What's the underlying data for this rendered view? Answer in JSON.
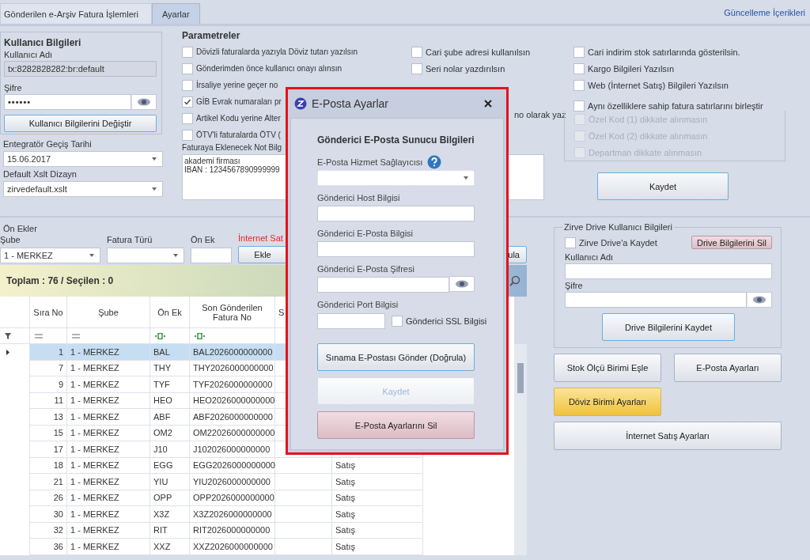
{
  "tabs": [
    {
      "label": "Gönderilen e-Arşiv Fatura İşlemleri",
      "selected": false
    },
    {
      "label": "Ayarlar",
      "selected": true
    }
  ],
  "update_link": "Güncelleme İçerikleri",
  "user_info": {
    "title": "Kullanıcı Bilgileri",
    "username_label": "Kullanıcı Adı",
    "username": "tx:8282828282:br:default",
    "password_label": "Şifre",
    "password": "••••••",
    "change_button": "Kullanıcı Bilgilerini Değiştir",
    "date_label": "Entegratör Geçiş Tarihi",
    "date": "15.06.2017",
    "xslt_label": "Default Xslt Dizayn",
    "xslt": "zirvedefault.xslt"
  },
  "parameters": {
    "title": "Parametreler",
    "column_1": [
      {
        "label": "Dövizli faturalarda yazıyla Döviz tutarı yazılsın",
        "checked": false
      },
      {
        "label": "Gönderimden önce kullanıcı onayı alınsın",
        "checked": false
      },
      {
        "label": "İrsaliye yerine geçer no",
        "checked": false
      },
      {
        "label": "GİB Evrak numaraları pr",
        "checked": true
      },
      {
        "label": "Artikel Kodu yerine Alter",
        "checked": false
      },
      {
        "label": "ÖTV'li faturalarda ÖTV (",
        "checked": false
      }
    ],
    "column_2": [
      {
        "kind": "checkbox",
        "label": "Cari şube adresi kullanılsın",
        "checked": false
      },
      {
        "kind": "checkbox",
        "label": "Seri nolar yazdırılsın",
        "checked": false
      },
      {
        "kind": "text",
        "label": "no olarak yaz"
      }
    ],
    "column_3": [
      {
        "label": "Cari indirim stok satırlarında gösterilsin.",
        "checked": false
      },
      {
        "label": "Kargo Bilgileri Yazılsın",
        "checked": false
      },
      {
        "label": "Web (İnternet Satış) Bilgileri Yazılsın",
        "checked": false
      }
    ],
    "merge_option": {
      "label": "Aynı özelliklere sahip fatura satırlarını birleştir",
      "checked": false
    },
    "merge_exceptions": [
      {
        "label": "Özel Kod (1) dikkate alınmasın",
        "checked": false,
        "disabled": true
      },
      {
        "label": "Özel Kod (2) dikkate alınmasın",
        "checked": false,
        "disabled": true
      },
      {
        "label": "Departman dikkate alınmasın",
        "checked": false,
        "disabled": true
      }
    ],
    "note_label": "Faturaya Eklenecek Not Bilg",
    "note_lines": [
      "akademi firması",
      "IBAN : 1234567890999999"
    ],
    "save_button": "Kaydet"
  },
  "prefixes": {
    "title": "Ön Ekler",
    "branch_label": "Şube",
    "branch": "1 - MERKEZ",
    "type_label": "Fatura Türü",
    "prefix_label": "Ön Ek",
    "warning": "İnternet Sat",
    "add_button": "Ekle",
    "right_button": "ula",
    "summary": "Toplam : 76 / Seçilen : 0",
    "columns": [
      {
        "label": "Sıra No"
      },
      {
        "label": "Şube"
      },
      {
        "label": "Ön Ek"
      },
      {
        "label": "Son Gönderilen Fatura No"
      },
      {
        "label": "S"
      }
    ],
    "rows": [
      {
        "sira_no": "1",
        "sube": "1 - MERKEZ",
        "on_ek": "BAL",
        "son_fatura_no": "BAL2026000000000",
        "selected": true
      },
      {
        "sira_no": "7",
        "sube": "1 - MERKEZ",
        "on_ek": "THY",
        "son_fatura_no": "THY2026000000000",
        "selected": false
      },
      {
        "sira_no": "9",
        "sube": "1 - MERKEZ",
        "on_ek": "TYF",
        "son_fatura_no": "TYF2026000000000",
        "selected": false
      },
      {
        "sira_no": "11",
        "sube": "1 - MERKEZ",
        "on_ek": "HEO",
        "son_fatura_no": "HEO2026000000000",
        "selected": false
      },
      {
        "sira_no": "13",
        "sube": "1 - MERKEZ",
        "on_ek": "ABF",
        "son_fatura_no": "ABF2026000000000",
        "selected": false
      },
      {
        "sira_no": "15",
        "sube": "1 - MERKEZ",
        "on_ek": "OM2",
        "son_fatura_no": "OM22026000000000",
        "selected": false
      },
      {
        "sira_no": "17",
        "sube": "1 - MERKEZ",
        "on_ek": "J10",
        "son_fatura_no": "J102026000000000",
        "selected": false
      },
      {
        "sira_no": "18",
        "sube": "1 - MERKEZ",
        "on_ek": "EGG",
        "son_fatura_no": "EGG2026000000000",
        "column_6": "Satış",
        "selected": false
      },
      {
        "sira_no": "21",
        "sube": "1 - MERKEZ",
        "on_ek": "YIU",
        "son_fatura_no": "YIU2026000000000",
        "column_6": "Satış",
        "selected": false
      },
      {
        "sira_no": "26",
        "sube": "1 - MERKEZ",
        "on_ek": "OPP",
        "son_fatura_no": "OPP2026000000000",
        "column_6": "Satış",
        "selected": false
      },
      {
        "sira_no": "30",
        "sube": "1 - MERKEZ",
        "on_ek": "X3Z",
        "son_fatura_no": "X3Z2026000000000",
        "column_6": "Satış",
        "selected": false
      },
      {
        "sira_no": "32",
        "sube": "1 - MERKEZ",
        "on_ek": "RIT",
        "son_fatura_no": "RIT2026000000000",
        "column_6": "Satış",
        "selected": false
      },
      {
        "sira_no": "36",
        "sube": "1 - MERKEZ",
        "on_ek": "XXZ",
        "son_fatura_no": "XXZ2026000000000",
        "column_6": "Satış",
        "selected": false
      }
    ]
  },
  "drive": {
    "title": "Zirve Drive Kullanıcı Bilgileri",
    "save_to_drive": {
      "label": "Zirve Drive'a Kaydet",
      "checked": false
    },
    "delete_button": "Drive Bilgilerini Sil",
    "username_label": "Kullanıcı Adı",
    "password_label": "Şifre",
    "save_button": "Drive Bilgilerini Kaydet"
  },
  "action_buttons": [
    {
      "label": "Stok Ölçü Birimi Eşle",
      "kind": "normal"
    },
    {
      "label": "E-Posta Ayarları",
      "kind": "normal"
    },
    {
      "label": "Döviz Birimi Ayarları",
      "kind": "highlighted"
    },
    {
      "label": "İnternet Satış Ayarları",
      "kind": "wide"
    }
  ],
  "dialog": {
    "title": "E-Posta Ayarlar",
    "heading": "Gönderici E-Posta Sunucu Bilgileri",
    "provider_label": "E-Posta Hizmet Sağlayıcısı",
    "host_label": "Gönderici Host Bilgisi",
    "email_label": "Gönderici E-Posta Bilgisi",
    "password_label": "Gönderici E-Posta Şifresi",
    "port_label": "Gönderici Port Bilgisi",
    "ssl": {
      "label": "Gönderici SSL Bilgisi",
      "checked": false
    },
    "buttons": [
      {
        "label": "Sınama E-Postası Gönder (Doğrula)",
        "kind": "primary",
        "disabled": false
      },
      {
        "label": "Kaydet",
        "kind": "normal",
        "disabled": true
      },
      {
        "label": "E-Posta Ayarlarını Sil",
        "kind": "danger",
        "disabled": false
      }
    ]
  }
}
